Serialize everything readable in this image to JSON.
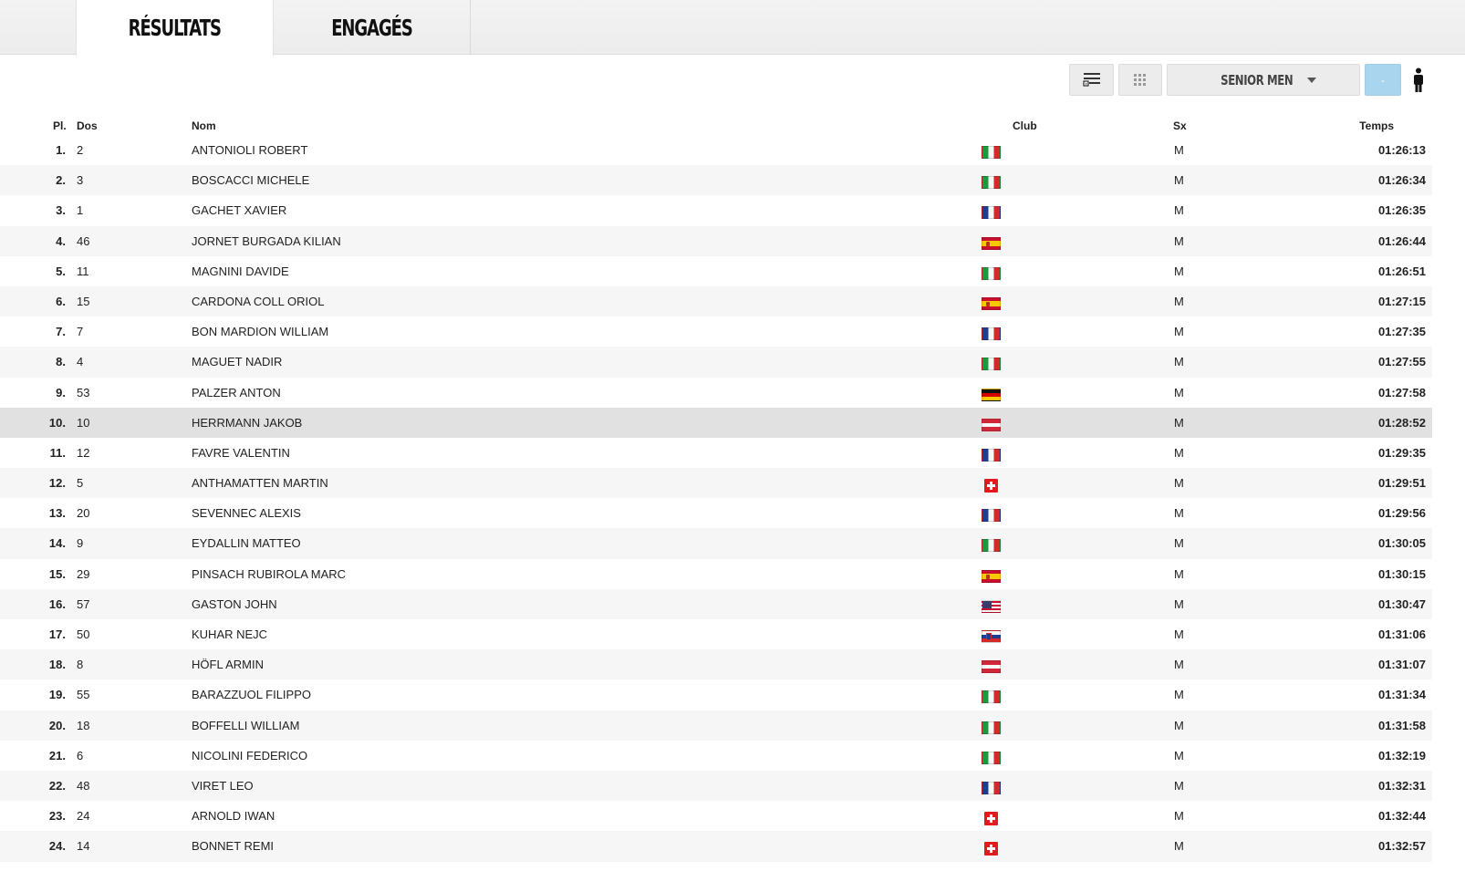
{
  "tabs": [
    {
      "label": "Résultats",
      "active": true
    },
    {
      "label": "Engagés",
      "active": false
    }
  ],
  "toolbar": {
    "list_icon": "list-add-icon",
    "grid_icon": "grid-icon",
    "category_label": "SENIOR MEN",
    "gender_label": "-",
    "person_icon": "person-icon"
  },
  "table": {
    "headers": {
      "pl": "Pl.",
      "dos": "Dos",
      "nom": "Nom",
      "club": "Club",
      "sx": "Sx",
      "temps": "Temps"
    },
    "rows": [
      {
        "pl": "1.",
        "dos": "2",
        "nom": "ANTONIOLI ROBERT",
        "flag": "it",
        "sx": "M",
        "temps": "01:26:13"
      },
      {
        "pl": "2.",
        "dos": "3",
        "nom": "BOSCACCI MICHELE",
        "flag": "it",
        "sx": "M",
        "temps": "01:26:34"
      },
      {
        "pl": "3.",
        "dos": "1",
        "nom": "GACHET XAVIER",
        "flag": "fr",
        "sx": "M",
        "temps": "01:26:35"
      },
      {
        "pl": "4.",
        "dos": "46",
        "nom": "JORNET BURGADA KILIAN",
        "flag": "es",
        "sx": "M",
        "temps": "01:26:44"
      },
      {
        "pl": "5.",
        "dos": "11",
        "nom": "MAGNINI DAVIDE",
        "flag": "it",
        "sx": "M",
        "temps": "01:26:51"
      },
      {
        "pl": "6.",
        "dos": "15",
        "nom": "CARDONA COLL ORIOL",
        "flag": "es",
        "sx": "M",
        "temps": "01:27:15"
      },
      {
        "pl": "7.",
        "dos": "7",
        "nom": "BON MARDION WILLIAM",
        "flag": "fr",
        "sx": "M",
        "temps": "01:27:35"
      },
      {
        "pl": "8.",
        "dos": "4",
        "nom": "MAGUET NADIR",
        "flag": "it",
        "sx": "M",
        "temps": "01:27:55"
      },
      {
        "pl": "9.",
        "dos": "53",
        "nom": "PALZER ANTON",
        "flag": "de",
        "sx": "M",
        "temps": "01:27:58"
      },
      {
        "pl": "10.",
        "dos": "10",
        "nom": "HERRMANN JAKOB",
        "flag": "at",
        "sx": "M",
        "temps": "01:28:52"
      },
      {
        "pl": "11.",
        "dos": "12",
        "nom": "FAVRE VALENTIN",
        "flag": "fr",
        "sx": "M",
        "temps": "01:29:35"
      },
      {
        "pl": "12.",
        "dos": "5",
        "nom": "ANTHAMATTEN MARTIN",
        "flag": "ch",
        "sx": "M",
        "temps": "01:29:51"
      },
      {
        "pl": "13.",
        "dos": "20",
        "nom": "SEVENNEC ALEXIS",
        "flag": "fr",
        "sx": "M",
        "temps": "01:29:56"
      },
      {
        "pl": "14.",
        "dos": "9",
        "nom": "EYDALLIN MATTEO",
        "flag": "it",
        "sx": "M",
        "temps": "01:30:05"
      },
      {
        "pl": "15.",
        "dos": "29",
        "nom": "PINSACH RUBIROLA MARC",
        "flag": "es",
        "sx": "M",
        "temps": "01:30:15"
      },
      {
        "pl": "16.",
        "dos": "57",
        "nom": "GASTON JOHN",
        "flag": "us",
        "sx": "M",
        "temps": "01:30:47"
      },
      {
        "pl": "17.",
        "dos": "50",
        "nom": "KUHAR NEJC",
        "flag": "si",
        "sx": "M",
        "temps": "01:31:06"
      },
      {
        "pl": "18.",
        "dos": "8",
        "nom": "HÖFL ARMIN",
        "flag": "at",
        "sx": "M",
        "temps": "01:31:07"
      },
      {
        "pl": "19.",
        "dos": "55",
        "nom": "BARAZZUOL FILIPPO",
        "flag": "it",
        "sx": "M",
        "temps": "01:31:34"
      },
      {
        "pl": "20.",
        "dos": "18",
        "nom": "BOFFELLI WILLIAM",
        "flag": "it",
        "sx": "M",
        "temps": "01:31:58"
      },
      {
        "pl": "21.",
        "dos": "6",
        "nom": "NICOLINI FEDERICO",
        "flag": "it",
        "sx": "M",
        "temps": "01:32:19"
      },
      {
        "pl": "22.",
        "dos": "48",
        "nom": "VIRET LEO",
        "flag": "fr",
        "sx": "M",
        "temps": "01:32:31"
      },
      {
        "pl": "23.",
        "dos": "24",
        "nom": "ARNOLD IWAN",
        "flag": "ch",
        "sx": "M",
        "temps": "01:32:44"
      },
      {
        "pl": "24.",
        "dos": "14",
        "nom": "BONNET REMI",
        "flag": "ch",
        "sx": "M",
        "temps": "01:32:57"
      }
    ],
    "highlighted_row_index": 9
  }
}
